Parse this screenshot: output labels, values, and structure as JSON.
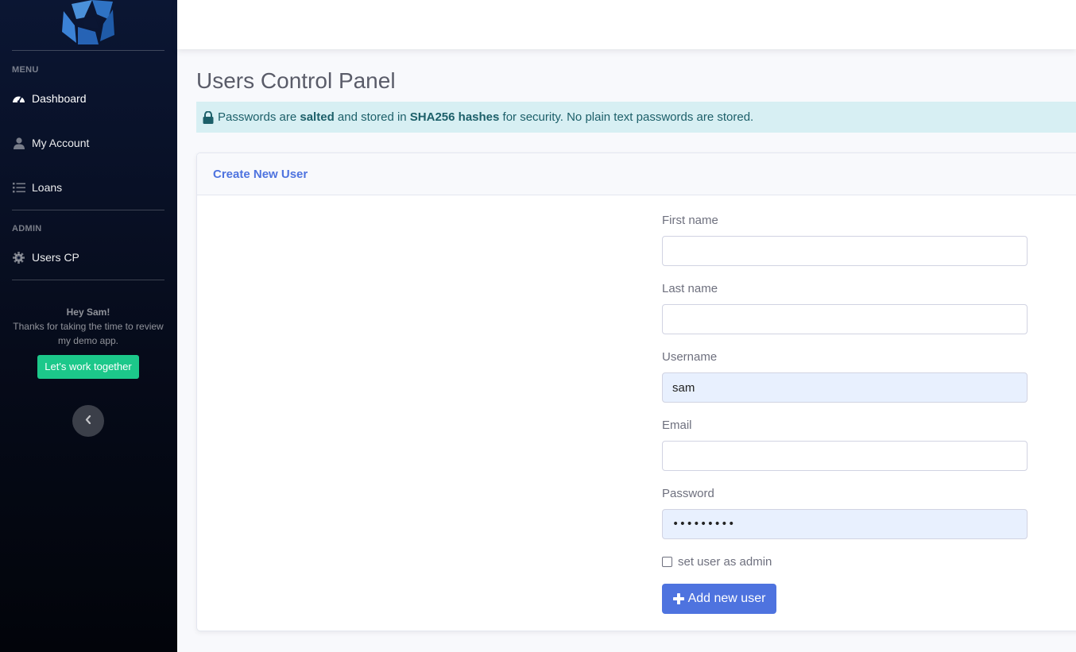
{
  "sidebar": {
    "menu_heading": "MENU",
    "admin_heading": "ADMIN",
    "items": [
      {
        "label": "Dashboard",
        "icon": "tachometer-icon"
      },
      {
        "label": "My Account",
        "icon": "user-icon"
      },
      {
        "label": "Loans",
        "icon": "list-icon"
      },
      {
        "label": "Users CP",
        "icon": "gear-icon"
      }
    ],
    "greeting": "Hey Sam!",
    "message": "Thanks for taking the time to review my demo app.",
    "cta_label": "Let's work together",
    "toggle_icon": "chevron-left-icon"
  },
  "main": {
    "title": "Users Control Panel",
    "alert": {
      "icon": "lock-icon",
      "t1": "Passwords are ",
      "b1": "salted",
      "t2": " and stored in ",
      "b2": "SHA256 hashes",
      "t3": " for security. No plain text passwords are stored."
    },
    "card": {
      "title": "Create New User",
      "fields": [
        {
          "label": "First name",
          "value": ""
        },
        {
          "label": "Last name",
          "value": ""
        },
        {
          "label": "Username",
          "value": "sam"
        },
        {
          "label": "Email",
          "value": ""
        },
        {
          "label": "Password",
          "value": "•••••••••"
        }
      ],
      "admin_checkbox_label": "set user as admin",
      "admin_checked": false,
      "submit_label": "Add new user"
    }
  },
  "colors": {
    "primary": "#4e73df",
    "success": "#1cc88a",
    "info_bg": "#d7eff3",
    "sidebar_dark": "#0b1633"
  }
}
